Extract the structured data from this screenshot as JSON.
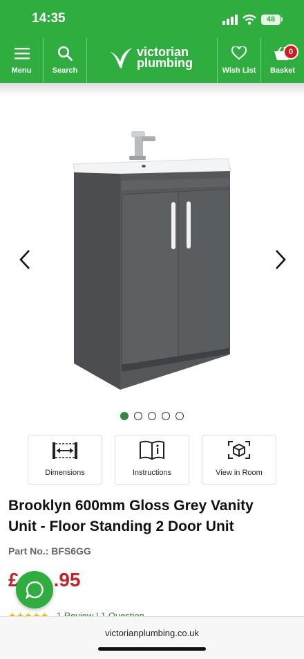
{
  "status_bar": {
    "time": "14:35",
    "battery": "48"
  },
  "nav": {
    "menu_label": "Menu",
    "search_label": "Search",
    "logo_line1": "victorian",
    "logo_line2": "plumbing",
    "wishlist_label": "Wish List",
    "basket_label": "Basket",
    "basket_count": "0"
  },
  "carousel": {
    "slide_count": 5,
    "active_slide": 1
  },
  "features": [
    {
      "label": "Dimensions",
      "icon": "dimensions-icon"
    },
    {
      "label": "Instructions",
      "icon": "instructions-book-icon"
    },
    {
      "label": "View in Room",
      "icon": "view-in-room-icon"
    }
  ],
  "product": {
    "title_line1": "Brooklyn 600mm Gloss Grey Vanity",
    "title_line2": "Unit - Floor Standing 2 Door Unit",
    "part_no": "Part No.: BFS6GG",
    "price_visible": ".95",
    "price_prefix": "£",
    "reviews_partial": "1 Review  |  1 Question"
  },
  "browser": {
    "url": "victorianplumbing.co.uk"
  },
  "colors": {
    "brand_green": "#2fae3f",
    "price_red": "#c0242a",
    "badge_red": "#d4191f"
  }
}
